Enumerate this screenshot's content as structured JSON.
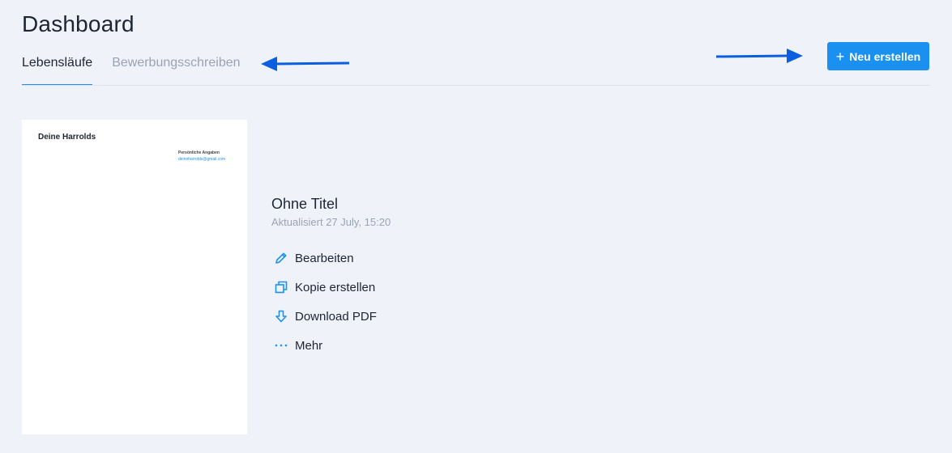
{
  "header": {
    "title": "Dashboard"
  },
  "tabs": [
    {
      "label": "Lebensläufe",
      "active": true
    },
    {
      "label": "Bewerbungsschreiben",
      "active": false
    }
  ],
  "toolbar": {
    "new_button_label": "Neu erstellen",
    "new_button_icon": "plus-icon"
  },
  "document": {
    "thumbnail": {
      "name": "Deine Harrolds",
      "section": "Persönliche Angaben",
      "email": "deineharrolds@gmail.com"
    },
    "title": "Ohne Titel",
    "updated": "Aktualisiert 27 July, 15:20",
    "actions": [
      {
        "label": "Bearbeiten",
        "icon": "pencil-icon"
      },
      {
        "label": "Kopie erstellen",
        "icon": "copy-icon"
      },
      {
        "label": "Download PDF",
        "icon": "download-icon"
      },
      {
        "label": "Mehr",
        "icon": "more-dots-icon"
      }
    ]
  },
  "colors": {
    "background": "#eff2f9",
    "accent": "#1a91f0",
    "text": "#1e2532",
    "muted": "#9aa3b3",
    "annotation_arrow": "#0a5ee0"
  }
}
